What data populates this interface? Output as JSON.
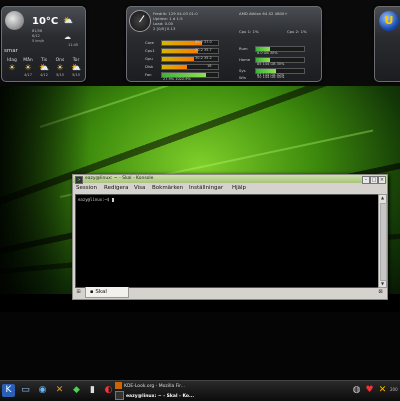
{
  "weather": {
    "temperature": "10°C",
    "detail_lines": [
      "81/56",
      "6/12",
      "5 km/h"
    ],
    "time_line": "11:45",
    "location": "smar",
    "days": [
      {
        "name": "Idag",
        "date": ""
      },
      {
        "name": "Mån",
        "date": "4/17"
      },
      {
        "name": "Tis",
        "date": "4/12"
      },
      {
        "name": "Ons",
        "date": "5/15"
      },
      {
        "name": "Tor",
        "date": "5/15"
      }
    ]
  },
  "sysmon": {
    "header_left": [
      "Fredrik: 129 04-03 01:0",
      "Uptime: 1 d 1:5",
      "Load: 0.00",
      "2 [0/0] 0.13"
    ],
    "header_right": "AMD Athlon 64 X2 4800+",
    "left_rows": [
      {
        "label": "Core",
        "value": "30.2 37.0",
        "fill": 0.72
      },
      {
        "label": "Cpu1",
        "value": "30.2 35.7",
        "fill": 0.64
      },
      {
        "label": "Gpu",
        "value": "30.2 35.2",
        "fill": 0.58
      },
      {
        "label": "Disk",
        "value": "16",
        "fill": 0.45
      },
      {
        "label": "Fan",
        "value": "27.9% 1022.9%",
        "fill": 0.78
      }
    ],
    "right_top": [
      "Cpu 1: 1%",
      "Cpu 2: 1%"
    ],
    "right_rows": [
      {
        "label": "Rum",
        "value": "6.0 GB 30%",
        "fill": 0.3
      },
      {
        "label": "Home",
        "value": "85 144 GB 30%",
        "fill": 0.3
      },
      {
        "label": "Sys",
        "value": "67 144 GB 42%",
        "fill": 0.42
      },
      {
        "label": "Win",
        "value": "50 144 GB 44%",
        "fill": 0.44
      }
    ]
  },
  "konsole": {
    "title": "eazy@linux: ~ - Skal - Konsole",
    "menus": [
      "Session",
      "Redigera",
      "Visa",
      "Bokmärken",
      "Inställningar",
      "Hjälp"
    ],
    "prompt": "eazy@linux:~$ ",
    "tab_label": "Skal"
  },
  "panel": {
    "tasks": [
      "KDE-Look.org - Mozilla Fir...",
      "eazy@linux: ~ - Skal - Ko..."
    ],
    "clock": "200"
  },
  "colors": {
    "terminal_bg": "#000000",
    "titlebar": "#b8d08a",
    "bar_warm": "#ff7a00",
    "bar_green": "#6fd045"
  },
  "icons": [
    "moon-icon",
    "sun-cloud-icon",
    "gauge-icon",
    "clock-ball-icon",
    "kde-menu-icon",
    "terminal-icon",
    "file-manager-icon",
    "browser-icon",
    "close-icon",
    "minimize-icon",
    "maximize-icon",
    "new-tab-icon"
  ]
}
